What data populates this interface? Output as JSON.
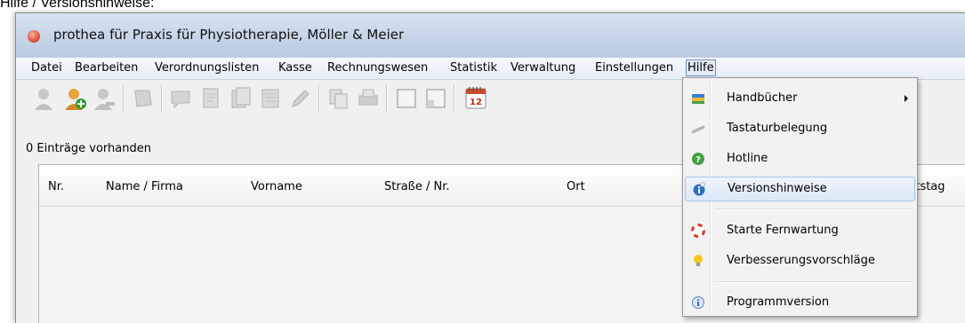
{
  "caption": "Hilfe / Versionshinweise:",
  "window": {
    "title": "prothea für Praxis für Physiotherapie, Möller & Meier",
    "icon": "app-logo-icon"
  },
  "menubar": {
    "items": [
      "Datei",
      "Bearbeiten",
      "Verordnungslisten",
      "Kasse",
      "Rechnungswesen",
      "Statistik",
      "Verwaltung",
      "Einstellungen",
      "Hilfe"
    ],
    "active": "Hilfe"
  },
  "toolbar": {
    "icons": [
      "user-icon",
      "add-user-icon",
      "remove-user-icon",
      "note-icon",
      "comment-icon",
      "document-icon",
      "documents-icon",
      "list-icon",
      "edit-icon",
      "copy-icon",
      "print-icon",
      "window-icon",
      "window-restore-icon",
      "calendar-icon"
    ],
    "calendar_day": "12"
  },
  "list": {
    "count_label": "0 Einträge vorhanden",
    "columns": [
      "Nr.",
      "Name / Firma",
      "Vorname",
      "Straße / Nr.",
      "Ort",
      "rtstag"
    ]
  },
  "help_menu": {
    "items": [
      {
        "label": "Handbücher",
        "icon": "books-icon",
        "submenu": true
      },
      {
        "label": "Tastaturbelegung",
        "icon": "keyboard-icon"
      },
      {
        "label": "Hotline",
        "icon": "hotline-icon"
      },
      {
        "label": "Versionshinweise",
        "icon": "info-icon",
        "highlighted": true
      },
      {
        "label": "Starte Fernwartung",
        "icon": "lifebuoy-icon"
      },
      {
        "label": "Verbesserungsvorschläge",
        "icon": "lightbulb-icon"
      },
      {
        "label": "Programmversion",
        "icon": "about-icon"
      }
    ]
  },
  "colors": {
    "menu_highlight": "#dce8f7",
    "titlebar": "#c4d3e6"
  }
}
